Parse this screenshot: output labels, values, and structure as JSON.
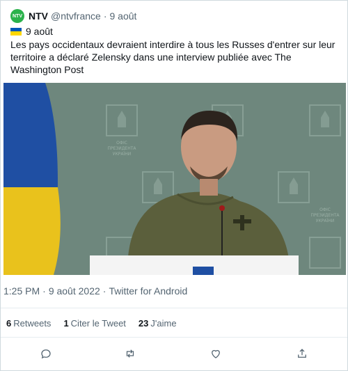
{
  "author": {
    "avatar_text": "NTV",
    "name": "NTV",
    "handle": "@ntvfrance",
    "separator": "·",
    "date": "9 août"
  },
  "tweet": {
    "flag_date": "9 août",
    "text": " Les pays occidentaux devraient interdire à tous les Russes d'entrer sur leur territoire a déclaré Zelensky dans une interview publiée avec The Washington Post"
  },
  "media": {
    "alt": "Photo of Volodymyr Zelensky speaking at a podium in front of a green backdrop with Ukrainian emblems and flag",
    "backdrop_text": [
      "ОФІС",
      "ПРЕЗИДЕНТА",
      "УКРАЇНИ"
    ]
  },
  "meta": {
    "time": "1:25 PM",
    "dot": "·",
    "date": "9 août 2022",
    "source": "Twitter for Android"
  },
  "stats": {
    "retweets_count": "6",
    "retweets_label": "Retweets",
    "quotes_count": "1",
    "quotes_label": "Citer le Tweet",
    "likes_count": "23",
    "likes_label": "J'aime"
  },
  "colors": {
    "avatar_bg": "#2bb24c",
    "text_primary": "#0f1419",
    "text_secondary": "#536471",
    "border": "#cfd9de",
    "flag_blue": "#0057b7",
    "flag_yellow": "#ffd700"
  },
  "icons": [
    "reply-icon",
    "retweet-icon",
    "like-icon",
    "share-icon"
  ]
}
